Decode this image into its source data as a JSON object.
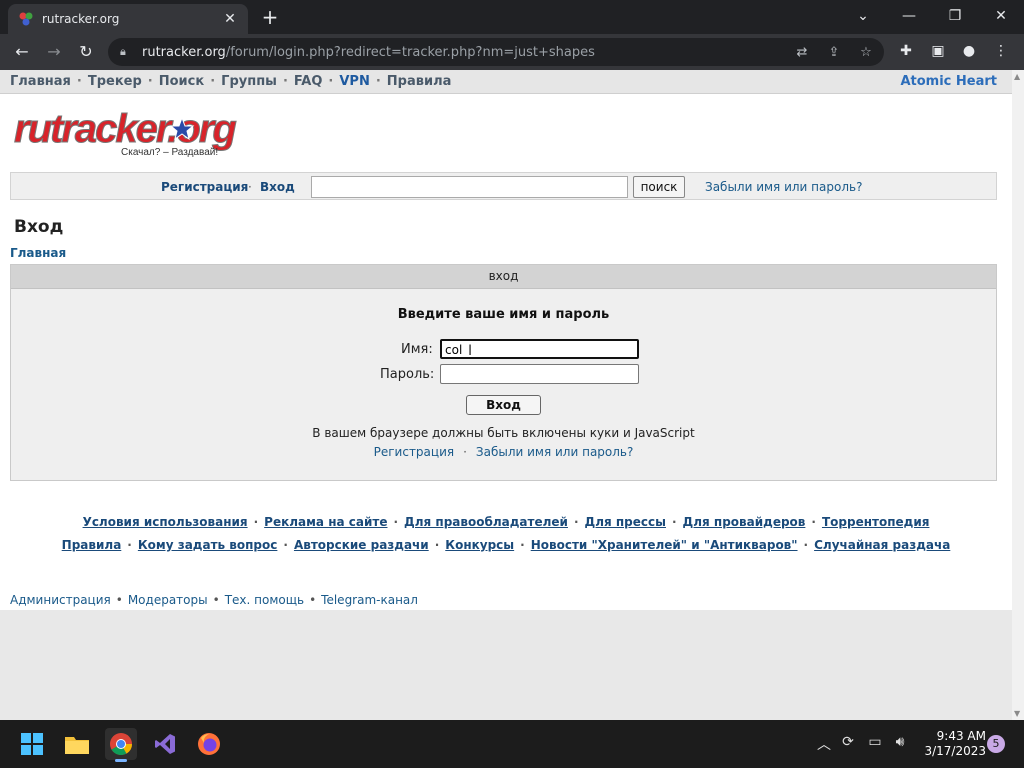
{
  "browser": {
    "tab_title": "rutracker.org",
    "url_host": "rutracker.org",
    "url_path": "/forum/login.php?redirect=tracker.php?nm=just+shapes"
  },
  "topmenu": {
    "items": [
      "Главная",
      "Трекер",
      "Поиск",
      "Группы",
      "FAQ",
      "VPN",
      "Правила"
    ],
    "right_link": "Atomic Heart"
  },
  "logo": {
    "text": "rutracker.org",
    "slogan": "Скачал? – Раздавай!"
  },
  "searchbar": {
    "register": "Регистрация",
    "login": "Вход",
    "search_value": "",
    "search_button": "поиск",
    "forgot": "Забыли имя или пароль?"
  },
  "page": {
    "title": "Вход",
    "breadcrumb": "Главная"
  },
  "login": {
    "header": "вход",
    "prompt": "Введите ваше имя и пароль",
    "username_label": "Имя:",
    "username_value": "col",
    "password_label": "Пароль:",
    "password_value": "",
    "submit": "Вход",
    "note": "В вашем браузере должны быть включены куки и JavaScript",
    "register_link": "Регистрация",
    "forgot_link": "Забыли имя или пароль?"
  },
  "footer": {
    "row1": [
      "Условия использования",
      "Реклама на сайте",
      "Для правообладателей",
      "Для прессы",
      "Для провайдеров",
      "Торрентопедия"
    ],
    "row2": [
      "Правила",
      "Кому задать вопрос",
      "Авторские раздачи",
      "Конкурсы",
      "Новости \"Хранителей\" и \"Антикваров\"",
      "Случайная раздача"
    ],
    "row3": [
      "Администрация",
      "Модераторы",
      "Тех. помощь",
      "Telegram-канал"
    ]
  },
  "taskbar": {
    "time": "9:43 AM",
    "date": "3/17/2023",
    "notifications": "5"
  },
  "colors": {
    "link": "#1a5a8a",
    "chrome_dark": "#202124",
    "chrome_toolbar": "#35363a",
    "logo_red": "#d8232a"
  }
}
